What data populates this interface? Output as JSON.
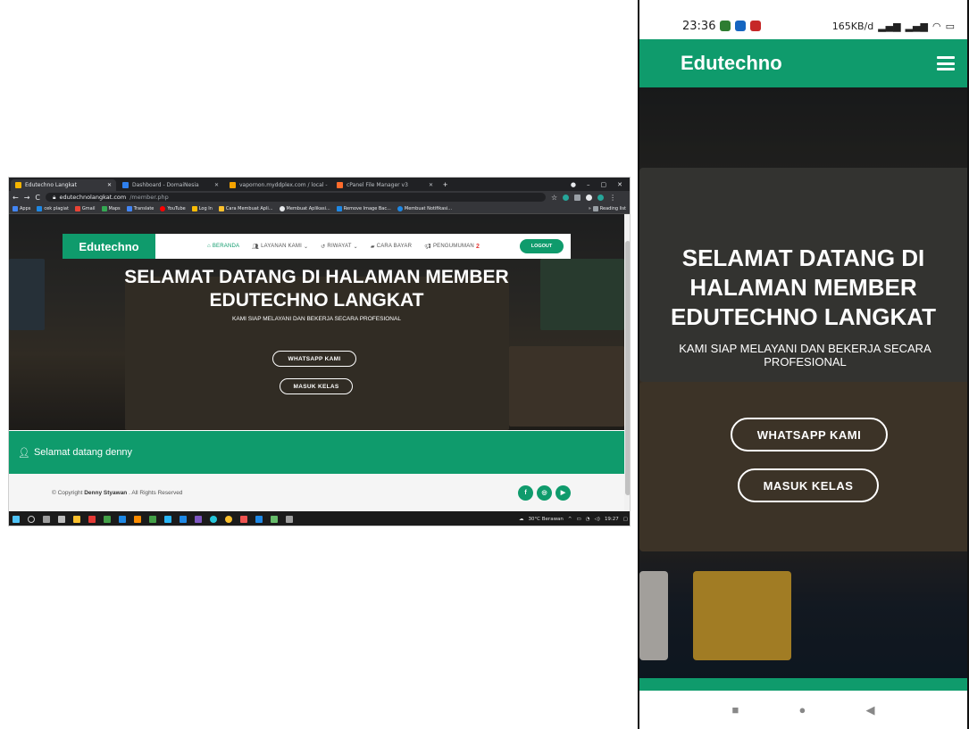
{
  "desktop": {
    "tabs": [
      {
        "label": "Edutechno Langkat",
        "color": "#f5b400"
      },
      {
        "label": "Dashboard - DomaiNesia",
        "color": "#ffffff"
      },
      {
        "label": "vapornon.myddplex.com / local -",
        "color": "#f4a300"
      },
      {
        "label": "cPanel File Manager v3",
        "color": "#ff6c2c"
      }
    ],
    "url": {
      "host": "edutechnolangkat.com",
      "path": "/member.php"
    },
    "bookmarks": [
      "Apps",
      "cek plagiat",
      "Gmail",
      "Maps",
      "Translate",
      "YouTube",
      "Log In",
      "Cara Membuat Apli...",
      "Membuat Aplikasi...",
      "Remove Image Bac...",
      "Membuat Notifikasi...",
      "Reading list"
    ],
    "site": {
      "brand": "Edutechno",
      "menu": [
        "BERANDA",
        "LAYANAN KAMI",
        "RIWAYAT",
        "CARA BAYAR",
        "PENGUMUMAN"
      ],
      "menu_badge": "2",
      "logout": "LOGOUT",
      "title_line1": "SELAMAT DATANG DI HALAMAN MEMBER",
      "title_line2": "EDUTECHNO LANGKAT",
      "subtitle": "KAMI SIAP MELAYANI DAN BEKERJA SECARA PROFESIONAL",
      "btn_whatsapp": "WHATSAPP KAMI",
      "btn_kelas": "MASUK KELAS",
      "greeting": "Selamat datang denny",
      "copyright_prefix": "© Copyright",
      "copyright_name": "Denny Styawan",
      "copyright_suffix": ". All Rights Reserved"
    },
    "tray": {
      "weather": "30°C Berawan",
      "time": "19:27"
    }
  },
  "phone": {
    "time": "23:36",
    "netspeed": "165KB/d",
    "brand": "Edutechno",
    "title": "SELAMAT DATANG DI HALAMAN MEMBER EDUTECHNO LANGKAT",
    "subtitle": "KAMI SIAP MELAYANI DAN BEKERJA SECARA PROFESIONAL",
    "btn_whatsapp": "WHATSAPP KAMI",
    "btn_kelas": "MASUK KELAS"
  },
  "colors": {
    "brand": "#0f9b6c",
    "badge": "#e53935"
  }
}
